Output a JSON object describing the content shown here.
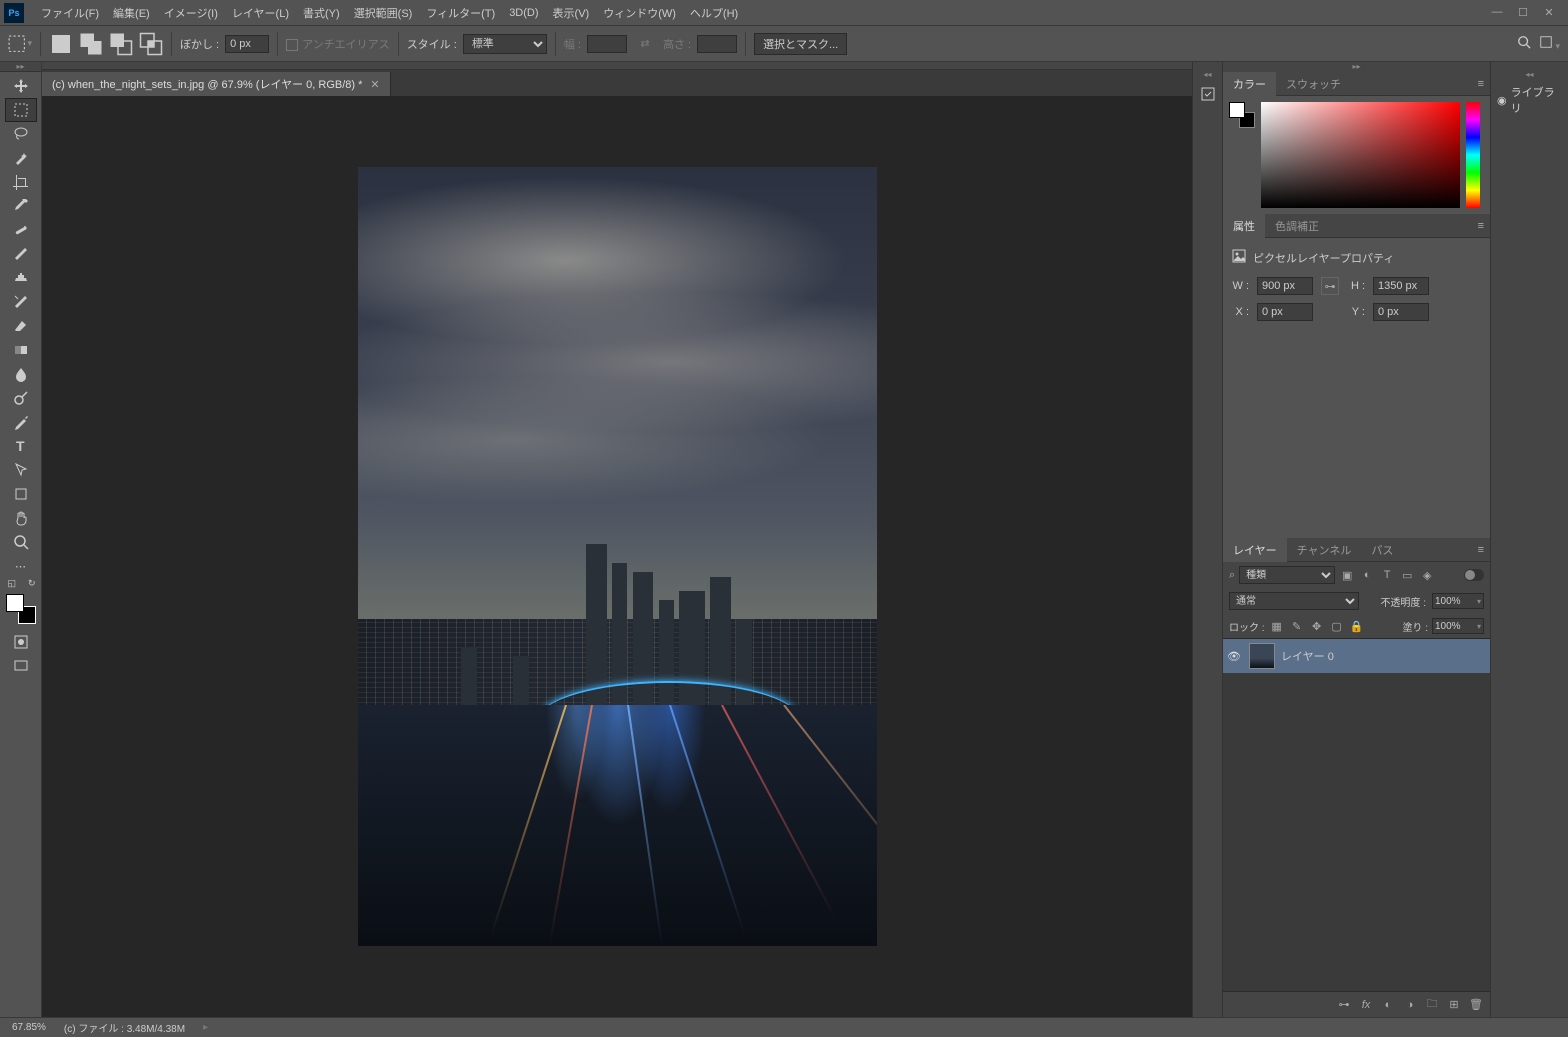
{
  "menu": {
    "items": [
      "ファイル(F)",
      "編集(E)",
      "イメージ(I)",
      "レイヤー(L)",
      "書式(Y)",
      "選択範囲(S)",
      "フィルター(T)",
      "3D(D)",
      "表示(V)",
      "ウィンドウ(W)",
      "ヘルプ(H)"
    ]
  },
  "options": {
    "feather_label": "ぼかし :",
    "feather_value": "0 px",
    "antialias_label": "アンチエイリアス",
    "style_label": "スタイル :",
    "style_value": "標準",
    "width_label": "幅 :",
    "height_label": "高さ :",
    "select_mask_label": "選択とマスク..."
  },
  "document": {
    "tab_title": "(c) when_the_night_sets_in.jpg @ 67.9% (レイヤー 0, RGB/8) *"
  },
  "panels": {
    "color_tab": "カラー",
    "swatch_tab": "スウォッチ",
    "props_tab": "属性",
    "adjust_tab": "色調補正",
    "props_title": "ピクセルレイヤープロパティ",
    "w_label": "W :",
    "w_value": "900 px",
    "h_label": "H :",
    "h_value": "1350 px",
    "x_label": "X :",
    "x_value": "0 px",
    "y_label": "Y :",
    "y_value": "0 px",
    "layers_tab": "レイヤー",
    "channels_tab": "チャンネル",
    "paths_tab": "パス",
    "kind_label": "種類",
    "blend_mode": "通常",
    "opacity_label": "不透明度 :",
    "opacity_value": "100%",
    "lock_label": "ロック :",
    "fill_label": "塗り :",
    "fill_value": "100%",
    "layer0_name": "レイヤー 0",
    "library_label": "ライブラリ"
  },
  "status": {
    "zoom": "67.85%",
    "info": "(c) ファイル : 3.48M/4.38M"
  }
}
